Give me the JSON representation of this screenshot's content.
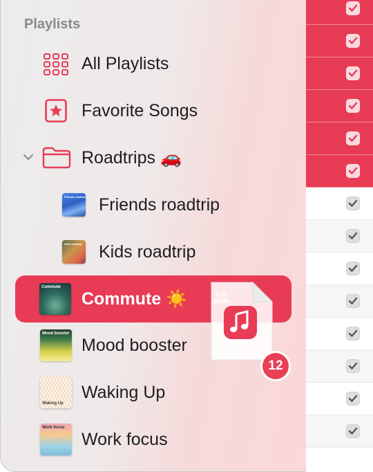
{
  "sidebar": {
    "section_title": "Playlists",
    "items": [
      {
        "label": "All Playlists",
        "icon": "grid-icon"
      },
      {
        "label": "Favorite Songs",
        "icon": "star-icon"
      },
      {
        "label": "Roadtrips 🚗",
        "icon": "folder-icon"
      },
      {
        "label": "Friends roadtrip",
        "icon": "playlist-artwork",
        "thumb_text": "Friends roadtrip"
      },
      {
        "label": "Kids roadtrip",
        "icon": "playlist-artwork",
        "thumb_text": "Kids roadtrip"
      },
      {
        "label": "Commute ☀️",
        "icon": "playlist-artwork",
        "thumb_text": "Commute",
        "selected": true
      },
      {
        "label": "Mood booster",
        "icon": "playlist-artwork",
        "thumb_text": "Mood booster"
      },
      {
        "label": "Waking Up",
        "icon": "playlist-artwork",
        "thumb_text": "Waking Up"
      },
      {
        "label": "Work focus",
        "icon": "playlist-artwork",
        "thumb_text": "Work focus"
      }
    ]
  },
  "drag": {
    "item_icon": "music-note-icon",
    "count": "12"
  },
  "table": {
    "rows_checked": [
      true,
      true,
      true,
      true,
      true,
      true,
      true,
      true,
      true,
      true,
      true,
      true,
      true,
      true
    ],
    "selected_rows": 6
  },
  "colors": {
    "accent": "#e83b55",
    "section_title": "#8a8a8e"
  }
}
